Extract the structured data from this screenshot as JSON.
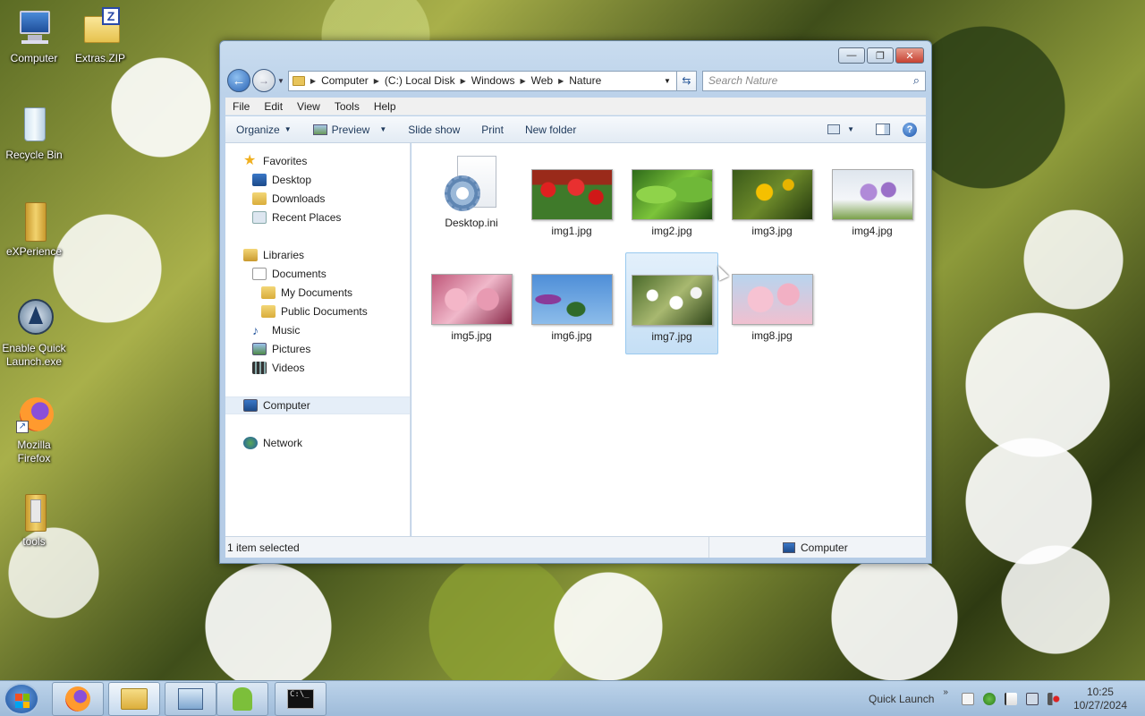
{
  "desktop": {
    "icons": [
      {
        "label": "Computer"
      },
      {
        "label": "Extras.ZIP"
      },
      {
        "label": "Recycle Bin"
      },
      {
        "label": "eXPerience"
      },
      {
        "label": "Enable Quick Launch.exe"
      },
      {
        "label": "Mozilla Firefox"
      },
      {
        "label": "tools"
      }
    ]
  },
  "window": {
    "controls": {
      "minimize": "—",
      "maximize": "❐",
      "close": "✕"
    },
    "address": {
      "crumbs": [
        "Computer",
        "(C:) Local Disk",
        "Windows",
        "Web",
        "Nature"
      ]
    },
    "search": {
      "placeholder": "Search Nature",
      "icon": "search-icon"
    },
    "menu": [
      "File",
      "Edit",
      "View",
      "Tools",
      "Help"
    ],
    "toolbar": {
      "organize": "Organize",
      "preview": "Preview",
      "slideshow": "Slide show",
      "print": "Print",
      "new_folder": "New folder",
      "help": "?"
    },
    "nav": {
      "favorites": "Favorites",
      "desktop": "Desktop",
      "downloads": "Downloads",
      "recent": "Recent Places",
      "libraries": "Libraries",
      "documents": "Documents",
      "my_documents": "My Documents",
      "public_documents": "Public Documents",
      "music": "Music",
      "pictures": "Pictures",
      "videos": "Videos",
      "computer": "Computer",
      "network": "Network"
    },
    "files": [
      {
        "name": "Desktop.ini"
      },
      {
        "name": "img1.jpg"
      },
      {
        "name": "img2.jpg"
      },
      {
        "name": "img3.jpg"
      },
      {
        "name": "img4.jpg"
      },
      {
        "name": "img5.jpg"
      },
      {
        "name": "img6.jpg"
      },
      {
        "name": "img7.jpg"
      },
      {
        "name": "img8.jpg"
      }
    ],
    "status": {
      "selection": "1 item selected",
      "location": "Computer"
    }
  },
  "taskbar": {
    "quick_launch": "Quick Launch",
    "time": "10:25",
    "date": "10/27/2024"
  },
  "colors": {
    "accent": "#2a63b5",
    "selection": "#cce4f7"
  }
}
